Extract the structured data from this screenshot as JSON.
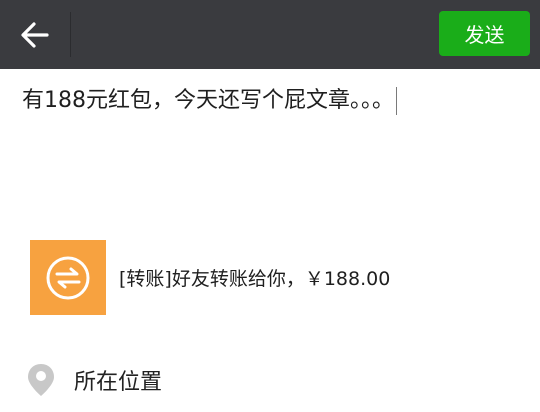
{
  "header": {
    "back_icon": "arrow-left-icon",
    "send_label": "发送",
    "send_color": "#1aad19",
    "bar_color": "#3a3b3f"
  },
  "composer": {
    "text": "有188元红包，今天还写个屁文章。。。"
  },
  "link_card": {
    "thumb_icon": "transfer-icon",
    "thumb_color": "#f7a240",
    "title": "[转账]好友转账给你，￥188.00"
  },
  "location": {
    "icon": "location-pin-icon",
    "label": "所在位置"
  }
}
